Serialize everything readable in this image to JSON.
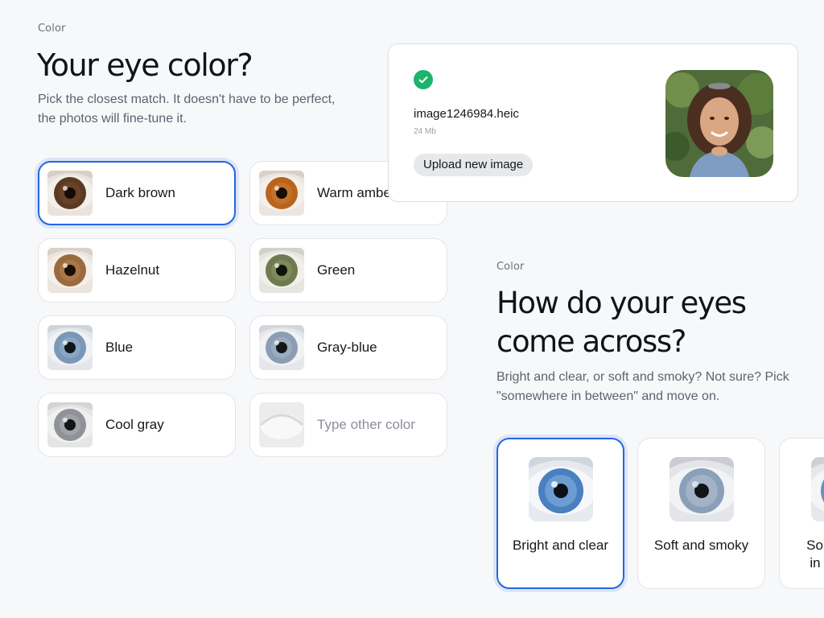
{
  "color_section": {
    "eyebrow": "Color",
    "title": "Your eye color?",
    "subtitle_line1": "Pick the closest match. It doesn't have to be perfect,",
    "subtitle_line2": "the photos will fine-tune it.",
    "options": [
      {
        "label": "Dark brown",
        "selected": true,
        "iris": "#5a3a22"
      },
      {
        "label": "Warm amber",
        "selected": false,
        "iris": "#b8641f"
      },
      {
        "label": "Hazelnut",
        "selected": false,
        "iris": "#9a6a3e"
      },
      {
        "label": "Green",
        "selected": false,
        "iris": "#6e7a4f"
      },
      {
        "label": "Blue",
        "selected": false,
        "iris": "#7b97b8"
      },
      {
        "label": "Gray-blue",
        "selected": false,
        "iris": "#8a9db3"
      },
      {
        "label": "Cool gray",
        "selected": false,
        "iris": "#8f9296"
      },
      {
        "label": "Type other color",
        "selected": false,
        "placeholder": true
      }
    ]
  },
  "upload": {
    "status_icon": "check-circle-icon",
    "file_name": "image1246984.heic",
    "file_size": "24 Mb",
    "button_label": "Upload new image"
  },
  "appearance_section": {
    "eyebrow": "Color",
    "title_line1": "How do your eyes",
    "title_line2": "come across?",
    "subtitle_line1": "Bright and clear, or soft and smoky? Not sure? Pick",
    "subtitle_line2": "\"somewhere in between\" and move on.",
    "options": [
      {
        "label_line1": "Bright and clear",
        "label_line2": "",
        "selected": true
      },
      {
        "label_line1": "Soft and smoky",
        "label_line2": "",
        "selected": false
      },
      {
        "label_line1": "Somewhere",
        "label_line2": "in between",
        "selected": false
      }
    ]
  },
  "colors": {
    "accent": "#2466e3",
    "success": "#1eb36a"
  }
}
